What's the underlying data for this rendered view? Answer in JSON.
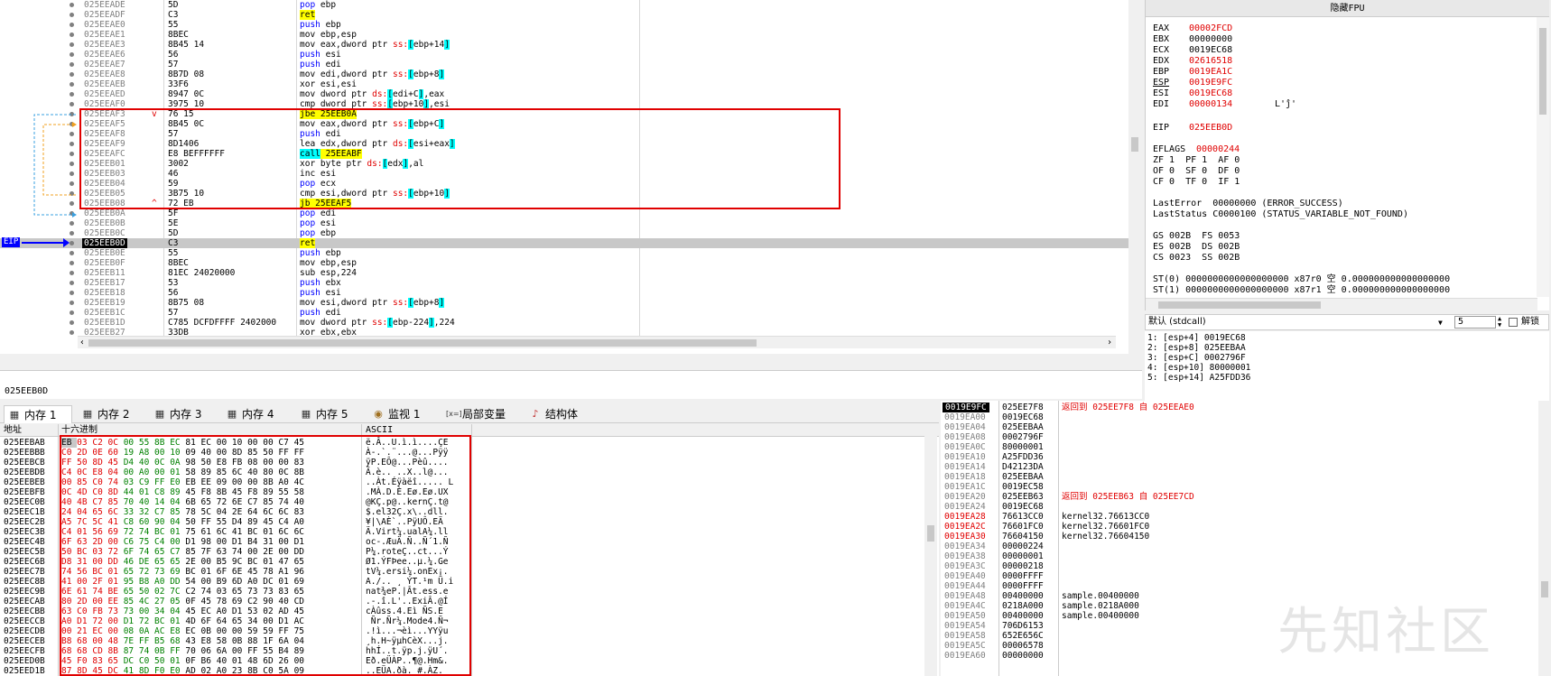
{
  "cpu": {
    "rows": [
      {
        "addr": "025EEADE",
        "bytes": "5D",
        "ins": "pop ebp"
      },
      {
        "addr": "025EEADF",
        "bytes": "C3",
        "ins": "ret"
      },
      {
        "addr": "025EEAE0",
        "bytes": "55",
        "ins": "push ebp"
      },
      {
        "addr": "025EEAE1",
        "bytes": "8BEC",
        "ins": "mov ebp,esp"
      },
      {
        "addr": "025EEAE3",
        "bytes": "8B45 14",
        "ins": "mov eax,dword ptr ss:[ebp+14]"
      },
      {
        "addr": "025EEAE6",
        "bytes": "56",
        "ins": "push esi"
      },
      {
        "addr": "025EEAE7",
        "bytes": "57",
        "ins": "push edi"
      },
      {
        "addr": "025EEAE8",
        "bytes": "8B7D 08",
        "ins": "mov edi,dword ptr ss:[ebp+8]"
      },
      {
        "addr": "025EEAEB",
        "bytes": "33F6",
        "ins": "xor esi,esi"
      },
      {
        "addr": "025EEAED",
        "bytes": "8947 0C",
        "ins": "mov dword ptr ds:[edi+C],eax"
      },
      {
        "addr": "025EEAF0",
        "bytes": "3975 10",
        "ins": "cmp dword ptr ss:[ebp+10],esi"
      },
      {
        "addr": "025EEAF3",
        "bytes": "76 15",
        "ins": "jbe 25EEB0A"
      },
      {
        "addr": "025EEAF5",
        "bytes": "8B45 0C",
        "ins": "mov eax,dword ptr ss:[ebp+C]"
      },
      {
        "addr": "025EEAF8",
        "bytes": "57",
        "ins": "push edi"
      },
      {
        "addr": "025EEAF9",
        "bytes": "8D1406",
        "ins": "lea edx,dword ptr ds:[esi+eax]"
      },
      {
        "addr": "025EEAFC",
        "bytes": "E8 BEFFFFFF",
        "ins": "call 25EEABF"
      },
      {
        "addr": "025EEB01",
        "bytes": "3002",
        "ins": "xor byte ptr ds:[edx],al"
      },
      {
        "addr": "025EEB03",
        "bytes": "46",
        "ins": "inc esi"
      },
      {
        "addr": "025EEB04",
        "bytes": "59",
        "ins": "pop ecx"
      },
      {
        "addr": "025EEB05",
        "bytes": "3B75 10",
        "ins": "cmp esi,dword ptr ss:[ebp+10]"
      },
      {
        "addr": "025EEB08",
        "bytes": "72 EB",
        "ins": "jb 25EEAF5"
      },
      {
        "addr": "025EEB0A",
        "bytes": "5F",
        "ins": "pop edi"
      },
      {
        "addr": "025EEB0B",
        "bytes": "5E",
        "ins": "pop esi"
      },
      {
        "addr": "025EEB0C",
        "bytes": "5D",
        "ins": "pop ebp"
      },
      {
        "addr": "025EEB0D",
        "bytes": "C3",
        "ins": "ret"
      },
      {
        "addr": "025EEB0E",
        "bytes": "55",
        "ins": "push ebp"
      },
      {
        "addr": "025EEB0F",
        "bytes": "8BEC",
        "ins": "mov ebp,esp"
      },
      {
        "addr": "025EEB11",
        "bytes": "81EC 24020000",
        "ins": "sub esp,224"
      },
      {
        "addr": "025EEB17",
        "bytes": "53",
        "ins": "push ebx"
      },
      {
        "addr": "025EEB18",
        "bytes": "56",
        "ins": "push esi"
      },
      {
        "addr": "025EEB19",
        "bytes": "8B75 08",
        "ins": "mov esi,dword ptr ss:[ebp+8]"
      },
      {
        "addr": "025EEB1C",
        "bytes": "57",
        "ins": "push edi"
      },
      {
        "addr": "025EEB1D",
        "bytes": "C785 DCFDFFFF 2402000",
        "ins": "mov dword ptr ss:[ebp-224],224"
      },
      {
        "addr": "025EEB27",
        "bytes": "33DB",
        "ins": "xor ebx,ebx"
      }
    ],
    "eip_label": "EIP",
    "jump_marks": {
      "jbe": "v",
      "jb": "^"
    }
  },
  "registers": {
    "header": "隐藏FPU",
    "regs": [
      {
        "name": "EAX",
        "value": "00002FCD",
        "red": true
      },
      {
        "name": "EBX",
        "value": "00000000",
        "red": false
      },
      {
        "name": "ECX",
        "value": "0019EC68",
        "red": false
      },
      {
        "name": "EDX",
        "value": "02616518",
        "red": true
      },
      {
        "name": "EBP",
        "value": "0019EA1C",
        "red": true
      },
      {
        "name": "ESP",
        "value": "0019E9FC",
        "red": true
      },
      {
        "name": "ESI",
        "value": "0019EC68",
        "red": true
      },
      {
        "name": "EDI",
        "value": "00000134",
        "red": true,
        "note": "L'ĵ'"
      }
    ],
    "eip": {
      "name": "EIP",
      "value": "025EEB0D"
    },
    "eflags": {
      "name": "EFLAGS",
      "value": "00000244"
    },
    "flags_lines": [
      "ZF 1  PF 1  AF 0",
      "OF 0  SF 0  DF 0",
      "CF 0  TF 0  IF 1"
    ],
    "last_error": "LastError  00000000 (ERROR_SUCCESS)",
    "last_status": "LastStatus C0000100 (STATUS_VARIABLE_NOT_FOUND)",
    "seg_lines": [
      "GS 002B  FS 0053",
      "ES 002B  DS 002B",
      "CS 0023  SS 002B"
    ],
    "st_lines": [
      "ST(0) 0000000000000000000 x87r0 空 0.000000000000000000",
      "ST(1) 0000000000000000000 x87r1 空 0.000000000000000000"
    ]
  },
  "callconv": {
    "label": "默认 (stdcall)",
    "count": "5",
    "unlock_label": "解锁"
  },
  "stack_args": [
    "1: [esp+4] 0019EC68",
    "2: [esp+8] 025EEBAA",
    "3: [esp+C] 0002796F",
    "4: [esp+10] 80000001",
    "5: [esp+14] A25FDD36"
  ],
  "cmdline": {
    "value": "025EEB0D"
  },
  "tabs": [
    {
      "label": "内存 1",
      "icon": "▦",
      "active": true
    },
    {
      "label": "内存 2",
      "icon": "▦",
      "active": false
    },
    {
      "label": "内存 3",
      "icon": "▦",
      "active": false
    },
    {
      "label": "内存 4",
      "icon": "▦",
      "active": false
    },
    {
      "label": "内存 5",
      "icon": "▦",
      "active": false
    },
    {
      "label": "监视 1",
      "icon": "◉",
      "active": false
    },
    {
      "label": "局部变量",
      "icon": "[x=]",
      "active": false
    },
    {
      "label": "结构体",
      "icon": "♪",
      "active": false
    }
  ],
  "dump": {
    "headers": {
      "addr": "地址",
      "hex": "十六进制",
      "ascii": "ASCII"
    },
    "rows": [
      {
        "addr": "025EEBAB",
        "hex": "EB 03 C2 0C 00 55 8B EC 81 EC 00 10 00 00 C7 45",
        "ascii": "ë.Â..U.ì.ì....ÇE"
      },
      {
        "addr": "025EEBBB",
        "hex": "C0 2D 0E 60 19 A8 00 10 09 40 00 8D 85 50 FF FF",
        "ascii": "À-.`.¨...@...Pÿÿ"
      },
      {
        "addr": "025EEBCB",
        "hex": "FF 50 8D 45 D4 40 0C 0A 98 50 E8 FB 08 00 00 83",
        "ascii": "ÿP.EÔ@...Pèû...."
      },
      {
        "addr": "025EEBDB",
        "hex": "C4 0C E8 04 00 A0 00 01 58 89 85 6C 40 80 0C 8B",
        "ascii": "Ä.è.. ..X..l@..."
      },
      {
        "addr": "025EEBEB",
        "hex": "00 85 C0 74 03 C9 FF E0 EB EE 09 00 00 8B A0 4C",
        "ascii": "..Àt.Éÿàëî..... L"
      },
      {
        "addr": "025EEBFB",
        "hex": "0C 4D C0 8D 44 01 C8 89 45 F8 8B 45 F8 89 55 58",
        "ascii": ".MÀ.D.È.Eø.Eø.UX"
      },
      {
        "addr": "025EEC0B",
        "hex": "40 4B C7 85 70 40 14 04 6B 65 72 6E C7 85 74 40",
        "ascii": "@KÇ.p@..kernÇ.t@"
      },
      {
        "addr": "025EEC1B",
        "hex": "24 04 65 6C 33 32 C7 85 78 5C 04 2E 64 6C 6C 83",
        "ascii": "$.el32Ç.x\\..dll."
      },
      {
        "addr": "025EEC2B",
        "hex": "A5 7C 5C 41 C8 60 90 04 50 FF 55 D4 89 45 C4 A0",
        "ascii": "¥|\\AÈ`..PÿUÔ.EÄ "
      },
      {
        "addr": "025EEC3B",
        "hex": "C4 01 56 69 72 74 BC 01 75 61 6C 41 BC 01 6C 6C",
        "ascii": "Ä.Virt¼.ualA¼.ll"
      },
      {
        "addr": "025EEC4B",
        "hex": "6F 63 2D 00 C6 75 C4 00 D1 98 00 D1 B4 31 00 D1",
        "ascii": "oc-.ÆuÄ.Ñ..Ñ´1.Ñ"
      },
      {
        "addr": "025EEC5B",
        "hex": "50 BC 03 72 6F 74 65 C7 85 7F 63 74 00 2E 00 DD",
        "ascii": "P¼.roteÇ..ct...Ý"
      },
      {
        "addr": "025EEC6B",
        "hex": "D8 31 00 DD 46 DE 65 65 2E 00 B5 9C BC 01 47 65",
        "ascii": "Ø1.ÝFÞee..µ.¼.Ge"
      },
      {
        "addr": "025EEC7B",
        "hex": "74 56 BC 01 65 72 73 69 BC 01 6F 6E 45 78 A1 96",
        "ascii": "tV¼.ersi¼.onEx¡."
      },
      {
        "addr": "025EEC8B",
        "hex": "41 00 2F 01 95 B8 A0 DD 54 00 B9 6D A0 DC 01 69",
        "ascii": "A./.. ¸ ÝT.¹m Ü.i"
      },
      {
        "addr": "025EEC9B",
        "hex": "6E 61 74 BE 65 50 02 7C C2 74 03 65 73 73 83 65",
        "ascii": "nat¾eP.|Ât.ess.e"
      },
      {
        "addr": "025EECAB",
        "hex": "80 2D 00 EE 85 4C 27 05 0F 45 78 69 C2 90 40 CD",
        "ascii": ".-.î.L'..ExiÂ.@Í"
      },
      {
        "addr": "025EECBB",
        "hex": "63 C0 FB 73 73 00 34 04 45 EC A0 D1 53 02 AD 45",
        "ascii": "cÀûss.4.Eì ÑS.­E"
      },
      {
        "addr": "025EECCB",
        "hex": "A0 D1 72 00 D1 72 BC 01 4D 6F 64 65 34 00 D1 AC",
        "ascii": " Ñr.Ñr¼.Mode4.Ñ¬"
      },
      {
        "addr": "025EECDB",
        "hex": "00 21 EC 00 08 0A AC E8 EC 0B 00 00 59 59 FF 75",
        "ascii": ".!ì...¬èì...YYÿu"
      },
      {
        "addr": "025EECEB",
        "hex": "B8 68 00 48 7E FF B5 68 43 E8 58 0B 88 1F 6A 04",
        "ascii": "¸h.H~ÿµhCèX...j."
      },
      {
        "addr": "025EECFB",
        "hex": "68 68 CD 8B 87 74 0B FF 70 06 6A 00 FF 55 B4 89",
        "ascii": "hhÍ..t.ÿp.j.ÿU´."
      },
      {
        "addr": "025EED0B",
        "hex": "45 F0 83 65 DC C0 50 01 0F B6 40 01 48 6D 26 00",
        "ascii": "Eð.eÜÀP..¶@.Hm&."
      },
      {
        "addr": "025EED1B",
        "hex": "87 8D 45 DC 41 8D F0 E0 AD 02 A0 23 8B C0 5A 09",
        "ascii": "..EÜA.ðà­. #.ÀZ."
      }
    ]
  },
  "stack": {
    "rows": [
      {
        "addr": "0019E9FC",
        "val": "025EE7F8",
        "comment": "返回到 025EE7F8 自 025EEAE0",
        "top": true,
        "red_comment": true,
        "red_addr": false
      },
      {
        "addr": "0019EA00",
        "val": "0019EC68",
        "comment": "",
        "top": false,
        "red_comment": false,
        "red_addr": false
      },
      {
        "addr": "0019EA04",
        "val": "025EEBAA",
        "comment": "",
        "top": false,
        "red_comment": false,
        "red_addr": false
      },
      {
        "addr": "0019EA08",
        "val": "0002796F",
        "comment": "",
        "top": false,
        "red_comment": false,
        "red_addr": false
      },
      {
        "addr": "0019EA0C",
        "val": "80000001",
        "comment": "",
        "top": false,
        "red_comment": false,
        "red_addr": false
      },
      {
        "addr": "0019EA10",
        "val": "A25FDD36",
        "comment": "",
        "top": false,
        "red_comment": false,
        "red_addr": false
      },
      {
        "addr": "0019EA14",
        "val": "D42123DA",
        "comment": "",
        "top": false,
        "red_comment": false,
        "red_addr": false
      },
      {
        "addr": "0019EA18",
        "val": "025EEBAA",
        "comment": "",
        "top": false,
        "red_comment": false,
        "red_addr": false
      },
      {
        "addr": "0019EA1C",
        "val": "0019EC58",
        "comment": "",
        "top": false,
        "red_comment": false,
        "red_addr": false
      },
      {
        "addr": "0019EA20",
        "val": "025EEB63",
        "comment": "返回到 025EEB63 自 025EE7CD",
        "top": false,
        "red_comment": true,
        "red_addr": false
      },
      {
        "addr": "0019EA24",
        "val": "0019EC68",
        "comment": "",
        "top": false,
        "red_comment": false,
        "red_addr": false
      },
      {
        "addr": "0019EA28",
        "val": "76613CC0",
        "comment": "kernel32.76613CC0",
        "top": false,
        "red_comment": false,
        "red_addr": true
      },
      {
        "addr": "0019EA2C",
        "val": "76601FC0",
        "comment": "kernel32.76601FC0",
        "top": false,
        "red_comment": false,
        "red_addr": true
      },
      {
        "addr": "0019EA30",
        "val": "76604150",
        "comment": "kernel32.76604150",
        "top": false,
        "red_comment": false,
        "red_addr": true
      },
      {
        "addr": "0019EA34",
        "val": "00000224",
        "comment": "",
        "top": false,
        "red_comment": false,
        "red_addr": false
      },
      {
        "addr": "0019EA38",
        "val": "00000001",
        "comment": "",
        "top": false,
        "red_comment": false,
        "red_addr": false
      },
      {
        "addr": "0019EA3C",
        "val": "00000218",
        "comment": "",
        "top": false,
        "red_comment": false,
        "red_addr": false
      },
      {
        "addr": "0019EA40",
        "val": "0000FFFF",
        "comment": "",
        "top": false,
        "red_comment": false,
        "red_addr": false
      },
      {
        "addr": "0019EA44",
        "val": "0000FFFF",
        "comment": "",
        "top": false,
        "red_comment": false,
        "red_addr": false
      },
      {
        "addr": "0019EA48",
        "val": "00400000",
        "comment": "sample.00400000",
        "top": false,
        "red_comment": false,
        "red_addr": false
      },
      {
        "addr": "0019EA4C",
        "val": "0218A000",
        "comment": "sample.0218A000",
        "top": false,
        "red_comment": false,
        "red_addr": false
      },
      {
        "addr": "0019EA50",
        "val": "00400000",
        "comment": "sample.00400000",
        "top": false,
        "red_comment": false,
        "red_addr": false
      },
      {
        "addr": "0019EA54",
        "val": "706D6153",
        "comment": "",
        "top": false,
        "red_comment": false,
        "red_addr": false
      },
      {
        "addr": "0019EA58",
        "val": "652E656C",
        "comment": "",
        "top": false,
        "red_comment": false,
        "red_addr": false
      },
      {
        "addr": "0019EA5C",
        "val": "00006578",
        "comment": "",
        "top": false,
        "red_comment": false,
        "red_addr": false
      },
      {
        "addr": "0019EA60",
        "val": "00000000",
        "comment": "",
        "top": false,
        "red_comment": false,
        "red_addr": false
      }
    ]
  },
  "watermark": "先知社区",
  "colors": {
    "highlight_yellow": "#ffff00",
    "highlight_cyan": "#00ffff",
    "red": "#e00000",
    "eip_blue": "#0000ff"
  }
}
